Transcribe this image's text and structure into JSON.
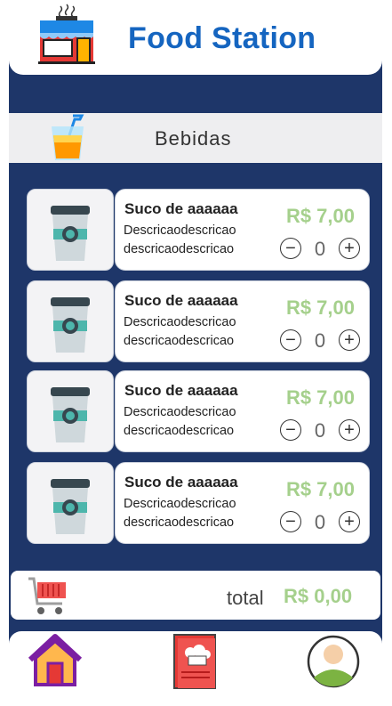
{
  "header": {
    "title": "Food Station",
    "logo_icon": "food-store-icon"
  },
  "category": {
    "title": "Bebidas",
    "icon": "juice-cup-icon"
  },
  "products": [
    {
      "name": "Suco de aaaaaa",
      "desc_line1": "Descricaodescricao",
      "desc_line2": "descricaodescricao",
      "price": "R$ 7,00",
      "quantity": "0",
      "minus": "−",
      "plus": "+"
    },
    {
      "name": "Suco de aaaaaa",
      "desc_line1": "Descricaodescricao",
      "desc_line2": "descricaodescricao",
      "price": "R$ 7,00",
      "quantity": "0",
      "minus": "−",
      "plus": "+"
    },
    {
      "name": "Suco de aaaaaa",
      "desc_line1": "Descricaodescricao",
      "desc_line2": "descricaodescricao",
      "price": "R$ 7,00",
      "quantity": "0",
      "minus": "−",
      "plus": "+"
    },
    {
      "name": "Suco de aaaaaa",
      "desc_line1": "Descricaodescricao",
      "desc_line2": "descricaodescricao",
      "price": "R$ 7,00",
      "quantity": "0",
      "minus": "−",
      "plus": "+"
    }
  ],
  "cart": {
    "label": "total",
    "value": "R$ 0,00",
    "icon": "shopping-cart-icon"
  },
  "nav": {
    "items": [
      "home-icon",
      "menu-book-icon",
      "profile-icon"
    ]
  },
  "colors": {
    "background": "#1e3669",
    "title": "#1565c0",
    "price": "#a5d08c"
  }
}
